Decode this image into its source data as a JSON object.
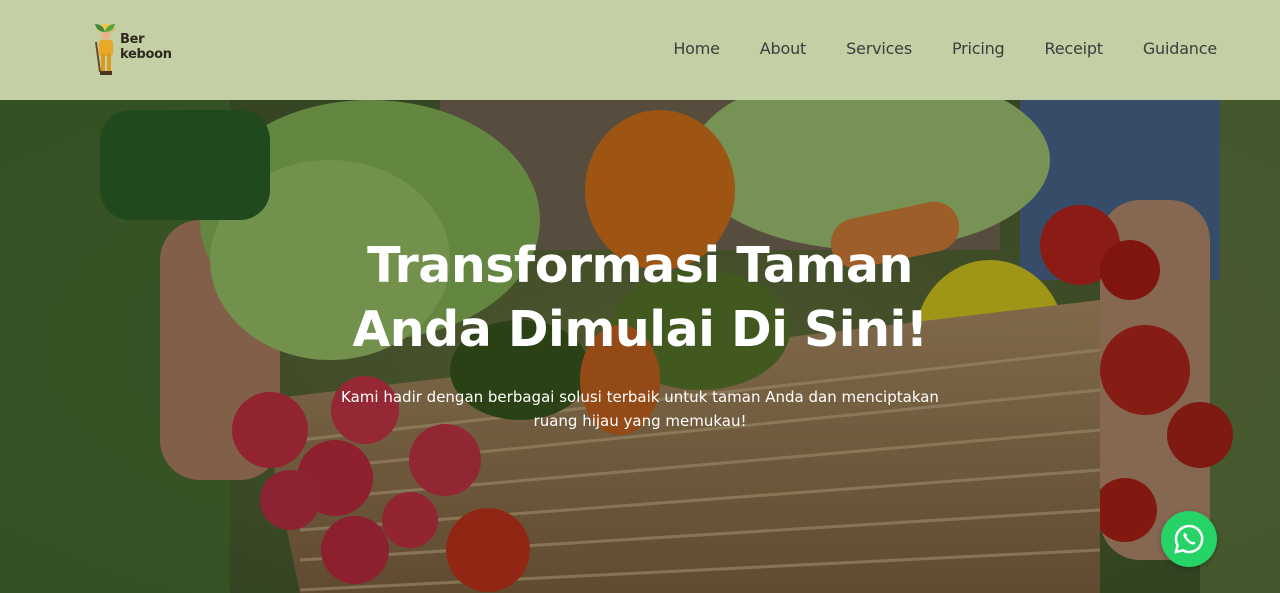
{
  "brand": {
    "logo_line1": "Ber",
    "logo_line2": "keboon"
  },
  "nav": {
    "items": [
      {
        "label": "Home"
      },
      {
        "label": "About"
      },
      {
        "label": "Services"
      },
      {
        "label": "Pricing"
      },
      {
        "label": "Receipt"
      },
      {
        "label": "Guidance"
      }
    ]
  },
  "hero": {
    "title": "Transformasi Taman Anda Dimulai Di Sini!",
    "subtitle": "Kami hadir dengan berbagai solusi terbaik untuk taman Anda dan menciptakan ruang hijau yang memukau!"
  },
  "floating": {
    "whatsapp_icon": "whatsapp-icon"
  },
  "colors": {
    "header_bg": "#c5cfa6",
    "nav_text": "#3c3c3c",
    "hero_text": "#ffffff",
    "whatsapp_green": "#25d366"
  }
}
